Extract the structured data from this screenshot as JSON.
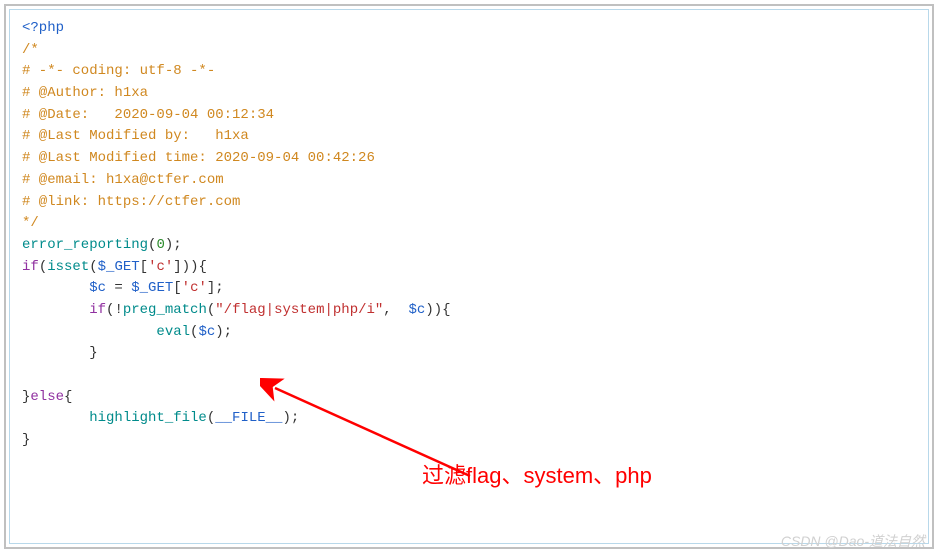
{
  "code": {
    "l0": "<?php",
    "l1": "",
    "l2": "/*",
    "l3": "# -*- coding: utf-8 -*-",
    "l4": "# @Author: h1xa",
    "l5": "# @Date:   2020-09-04 00:12:34",
    "l6": "# @Last Modified by:   h1xa",
    "l7": "# @Last Modified time: 2020-09-04 00:42:26",
    "l8": "# @email: h1xa@ctfer.com",
    "l9": "# @link: https://ctfer.com",
    "l10": "",
    "l11": "*/",
    "l12": "",
    "fn_error": "error_reporting",
    "p_open": "(",
    "v_zero": "0",
    "p_close_semi": ");",
    "kw_if": "if",
    "fn_isset": "isset",
    "var_get": "$_GET",
    "br_open": "[",
    "str_c": "'c'",
    "br_close": "]",
    "p_close": ")",
    "brace_open": "{",
    "brace_close": "}",
    "indent1": "        ",
    "indent2": "                ",
    "var_c": "$c",
    "assign": " = ",
    "semi": ";",
    "bang": "!",
    "fn_pregmatch": "preg_match",
    "comma_sp": ",  ",
    "str_regex": "\"/flag|system|php/i\"",
    "fn_eval": "eval",
    "kw_else": "else",
    "fn_highlight": "highlight_file",
    "const_file": "__FILE__"
  },
  "annotation": {
    "text": "过滤flag、system、php"
  },
  "watermark": "CSDN @Dao-道法自然"
}
